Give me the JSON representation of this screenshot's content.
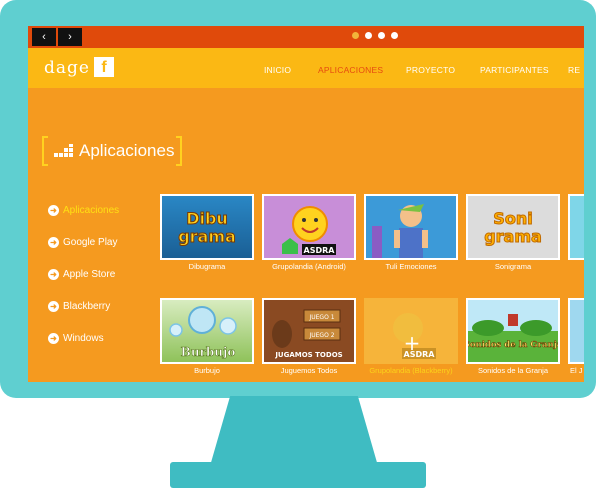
{
  "nav": {
    "back": "‹",
    "forward": "›"
  },
  "header": {
    "logo": "dage",
    "facebook": "f",
    "menu": [
      "INICIO",
      "APLICACIONES",
      "PROYECTO",
      "PARTICIPANTES",
      "RE"
    ]
  },
  "page_title": "Aplicaciones",
  "sidebar": {
    "items": [
      "Aplicaciones",
      "Google Play",
      "Apple Store",
      "Blackberry",
      "Windows"
    ]
  },
  "apps_row1": [
    "Dibugrama",
    "Grupolandia (Android)",
    "Tuli Emociones",
    "Sonigrama"
  ],
  "apps_row2": [
    "Burbujo",
    "Juguemos Todos",
    "Grupolandia (Blackberry)",
    "Sonidos de la Granja",
    "El J"
  ],
  "thumb_text": {
    "dibugrama": [
      "Dibu",
      "grama"
    ],
    "asdra": "ASDRA",
    "sonigrama": [
      "Soni",
      "grama"
    ],
    "burbujo": "Burbujo",
    "juguemos": "JUGAMOS TODOS",
    "juego1": "JUEGO 1",
    "juego2": "JUEGO 2",
    "granja": "Sonidos de la Granja"
  },
  "colors": {
    "screen_bg": "#f59a1f",
    "header_bg": "#fbb814",
    "topbar_bg": "#e04a0b",
    "monitor": "#5fcfd0",
    "active_nav": "#e64b10"
  }
}
